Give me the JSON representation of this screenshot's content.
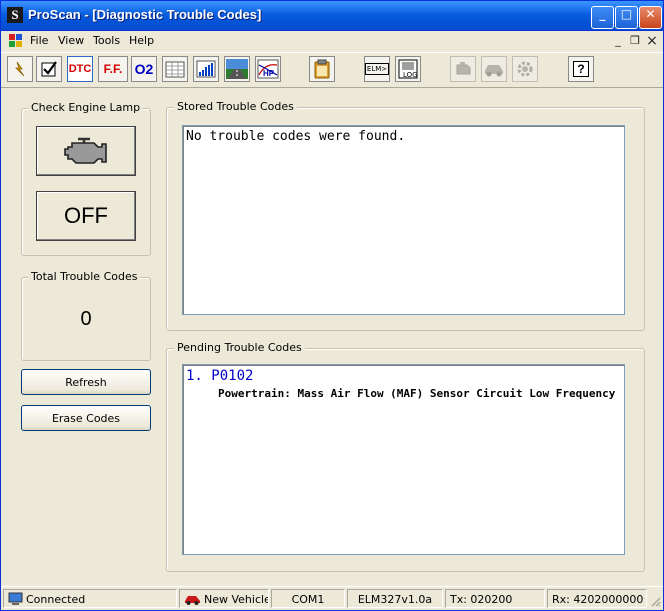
{
  "window": {
    "title": "ProScan - [Diagnostic Trouble Codes]",
    "app_icon_glyph": "S",
    "minimize_glyph": "_",
    "maximize_glyph": "□",
    "close_glyph": "✕"
  },
  "menu": {
    "items": [
      "File",
      "View",
      "Tools",
      "Help"
    ],
    "mdi_minimize": "_",
    "mdi_restore": "❐",
    "mdi_close": "×"
  },
  "toolbar": {
    "dtc_label": "DTC",
    "ff_label": "F.F.",
    "o2_label": "O2",
    "elm_label": "ELM>",
    "log_label": "LOG",
    "hp_label": "HP",
    "help_label": "?"
  },
  "check_engine": {
    "title": "Check Engine Lamp",
    "state": "OFF"
  },
  "total_codes": {
    "title": "Total Trouble Codes",
    "count": "0"
  },
  "buttons": {
    "refresh": "Refresh",
    "erase": "Erase Codes"
  },
  "stored": {
    "title": "Stored Trouble Codes",
    "message": "No trouble codes were found."
  },
  "pending": {
    "title": "Pending Trouble Codes",
    "codes": [
      {
        "index": "1.",
        "code": "P0102",
        "description": "Powertrain: Mass Air Flow (MAF) Sensor Circuit Low Frequency"
      }
    ]
  },
  "status": {
    "connection": "Connected",
    "vehicle": "New Vehicle",
    "port": "COM1",
    "interface": "ELM327v1.0a",
    "tx": "Tx: 020200",
    "rx": "Rx: 4202000000"
  },
  "colors": {
    "code_blue": "#0000c8",
    "title_blue": "#0a5fe0",
    "dtc_red": "#d40000",
    "o2_blue": "#0000c0"
  }
}
